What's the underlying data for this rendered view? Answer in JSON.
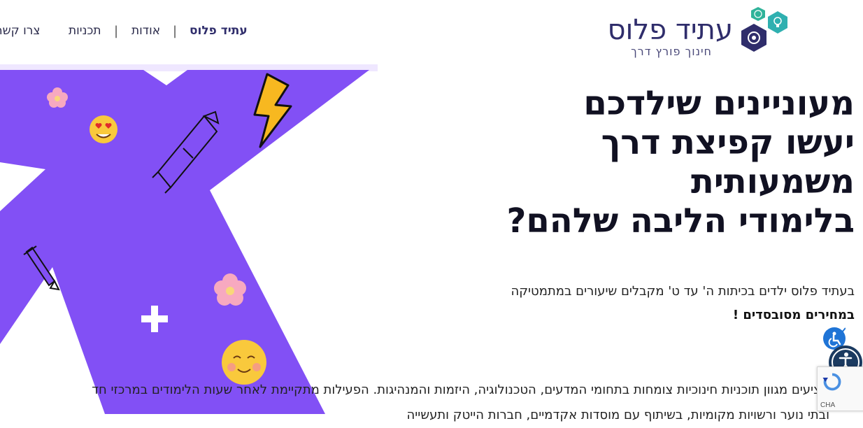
{
  "nav": {
    "items": [
      {
        "label": "עתיד פלוס",
        "active": true
      },
      {
        "label": "אודות",
        "active": false
      },
      {
        "label": "תכניות",
        "active": false
      },
      {
        "label": "צרו קשר",
        "active": false
      }
    ],
    "separator": "|"
  },
  "logo": {
    "name": "עתיד פלוס",
    "slogan": "חינוך פורץ דרך",
    "icons": [
      "atom-icon",
      "lightbulb-icon",
      "gear-icon"
    ]
  },
  "hero": {
    "headline_lines": [
      "מעוניינים שילדכם",
      "יעשו קפיצת דרך",
      "משמעותית",
      "בלימודי הליבה שלהם?"
    ],
    "intro_text": "בעתיד פלוס ילדים בכיתות ה' עד ט' מקבלים שיעורים במתמטיקה",
    "intro_bold": "במחירים מסובסדים !",
    "description": "מציעים מגוון תוכניות חינוכיות צומחות בתחומי המדעים, הטכנולוגיה, היזמות והמנהיגות. הפעילות מתקיימת לאחר שעות הלימודים במרכזי חד",
    "description_line2": "ובתי נוער ורשויות מקומיות, בשיתוף עם מוסדות אקדמיים, חברות הייטק ותעשייה"
  },
  "art": {
    "stickers": [
      "lightning-icon",
      "heart-eyes-emoji-icon",
      "flower-icon",
      "rocket-icon",
      "plus-icon",
      "smile-emoji-icon"
    ],
    "colors": {
      "x_shape": "#8250f5",
      "lightning": "#f7b820",
      "flower": "#f7a9c0",
      "emoji": "#f9c93c"
    }
  },
  "widgets": {
    "recaptcha_label": "CHA"
  },
  "colors": {
    "brand": "#2f2d6b",
    "accent": "#8250f5",
    "teal": "#30b39a",
    "a11y": "#1b3a60"
  }
}
